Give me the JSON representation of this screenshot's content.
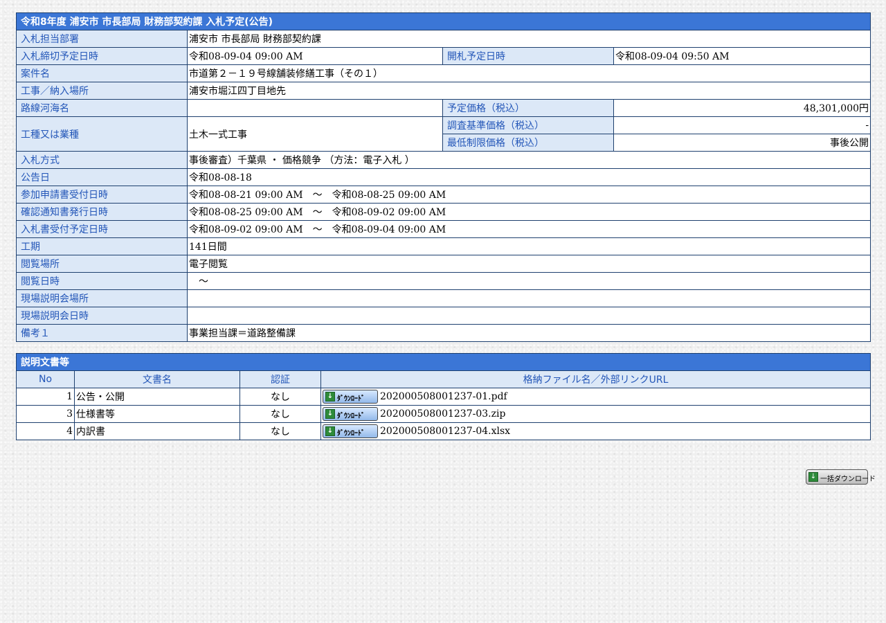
{
  "notice": {
    "title": "令和8年度 浦安市 市長部局 財務部契約課 入札予定(公告)",
    "rows": {
      "department": {
        "label": "入札担当部署",
        "value": "浦安市 市長部局 財務部契約課"
      },
      "deadline": {
        "label": "入札締切予定日時",
        "value": "令和08-09-04 09:00 AM"
      },
      "opening": {
        "label": "開札予定日時",
        "value": "令和08-09-04 09:50 AM"
      },
      "project_name": {
        "label": "案件名",
        "value": "市道第２－１９号線舗装修繕工事（その１）"
      },
      "location": {
        "label": "工事／納入場所",
        "value": "浦安市堀江四丁目地先"
      },
      "route": {
        "label": "路線河海名",
        "value": ""
      },
      "planned_price": {
        "label": "予定価格（税込）",
        "value": "48,301,000円"
      },
      "work_type": {
        "label": "工種又は業種",
        "value": "土木一式工事"
      },
      "survey_price": {
        "label": "調査基準価格（税込）",
        "value": "-"
      },
      "min_price": {
        "label": "最低制限価格（税込）",
        "value": "事後公開"
      },
      "bid_method": {
        "label": "入札方式",
        "value": "事後審査）千葉県 ・ 価格競争 （方法：電子入札 ）"
      },
      "announce_date": {
        "label": "公告日",
        "value": "令和08-08-18"
      },
      "application": {
        "label": "参加申請書受付日時",
        "value": "令和08-08-21 09:00 AM　～　令和08-08-25 09:00 AM"
      },
      "confirmation": {
        "label": "確認通知書発行日時",
        "value": "令和08-08-25 09:00 AM　～　令和08-09-02 09:00 AM"
      },
      "bid_receipt": {
        "label": "入札書受付予定日時",
        "value": "令和08-09-02 09:00 AM　～　令和08-09-04 09:00 AM"
      },
      "period": {
        "label": "工期",
        "value": "141日間"
      },
      "viewing_place": {
        "label": "閲覧場所",
        "value": "電子閲覧"
      },
      "viewing_time": {
        "label": "閲覧日時",
        "value": "　～"
      },
      "briefing_place": {
        "label": "現場説明会場所",
        "value": ""
      },
      "briefing_time": {
        "label": "現場説明会日時",
        "value": ""
      },
      "remarks1": {
        "label": "備考１",
        "value": "事業担当課＝道路整備課"
      }
    }
  },
  "documents": {
    "title": "説明文書等",
    "headers": {
      "no": "No",
      "name": "文書名",
      "auth": "認証",
      "file": "格納ファイル名／外部リンクURL"
    },
    "download_label": "ﾀﾞｳﾝﾛｰﾄﾞ",
    "download_icon": "download-disk-icon",
    "items": [
      {
        "no": "1",
        "name": "公告・公開",
        "auth": "なし",
        "file": "202000508001237-01.pdf"
      },
      {
        "no": "3",
        "name": "仕様書等",
        "auth": "なし",
        "file": "202000508001237-03.zip"
      },
      {
        "no": "4",
        "name": "内訳書",
        "auth": "なし",
        "file": "202000508001237-04.xlsx"
      }
    ]
  },
  "bulk_download": {
    "label": "一括ダウンロード",
    "icon": "download-disk-icon"
  },
  "colors": {
    "caption_bg": "#3b76d6",
    "label_bg": "#dce8f7",
    "label_text": "#2356b8",
    "border": "#1d3f6e"
  }
}
